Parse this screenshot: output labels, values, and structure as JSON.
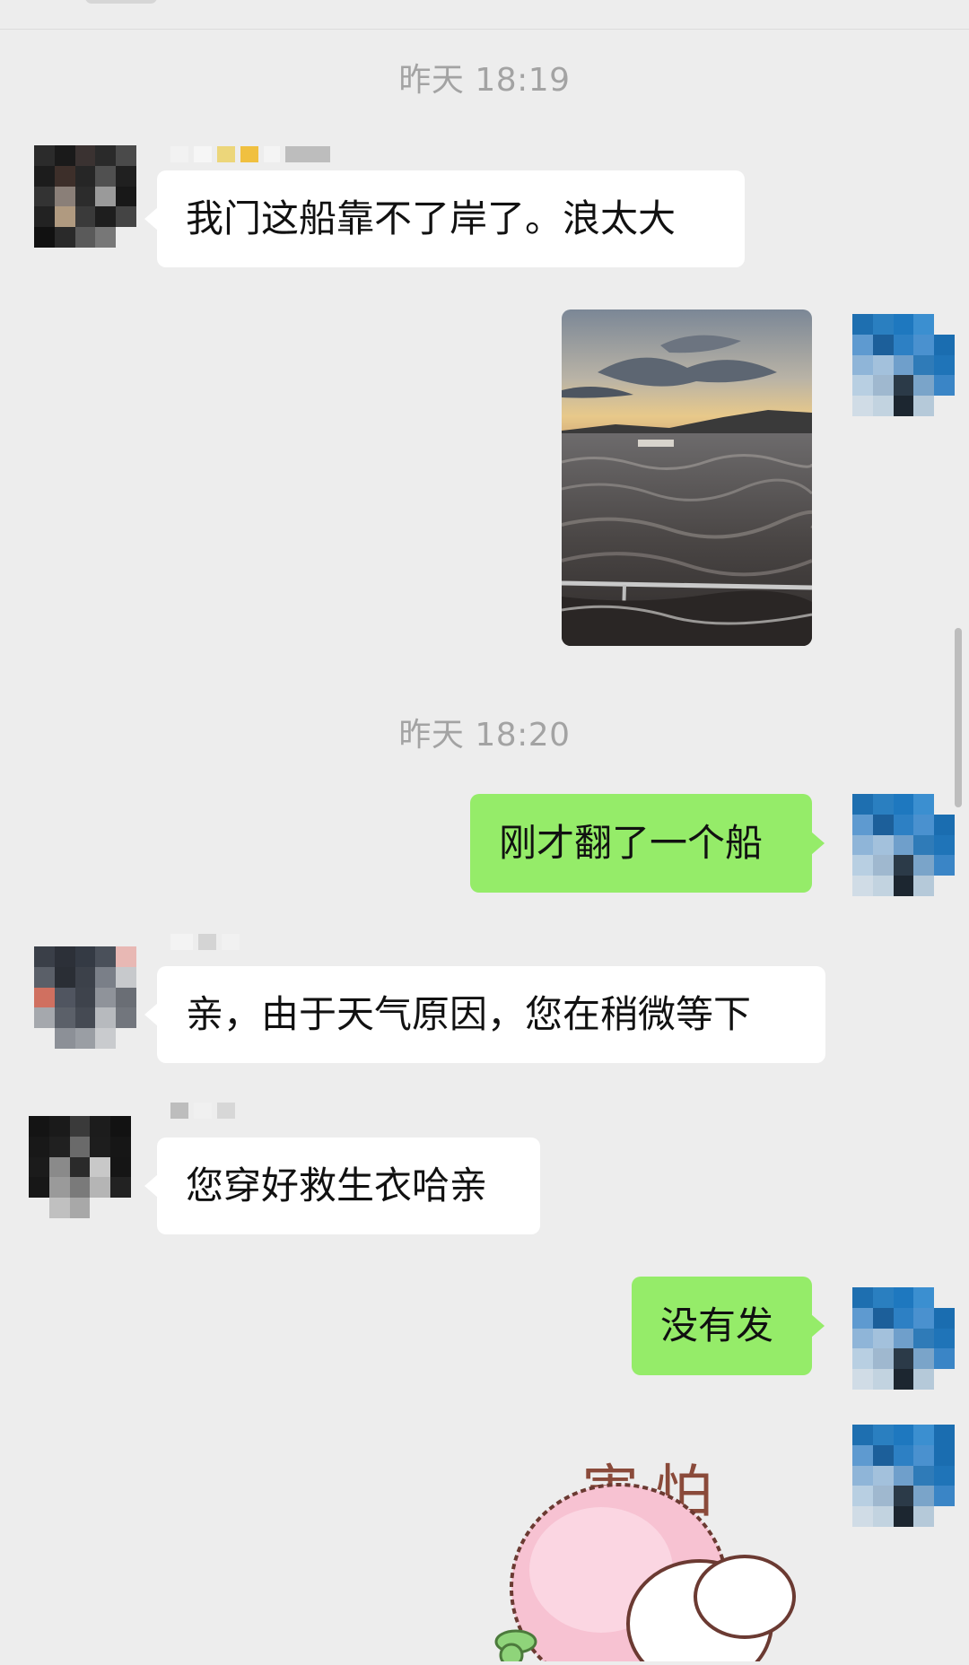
{
  "chat": {
    "timestamps": [
      "昨天 18:19",
      "昨天 18:20"
    ],
    "messages": [
      {
        "side": "incoming",
        "type": "text",
        "text": "我门这船靠不了岸了。浪太大"
      },
      {
        "side": "outgoing",
        "type": "image",
        "content": "photo of rough sea at dusk"
      },
      {
        "side": "outgoing",
        "type": "text",
        "text": "刚才翻了一个船"
      },
      {
        "side": "incoming",
        "type": "text",
        "text": "亲，由于天气原因，您在稍微等下"
      },
      {
        "side": "incoming",
        "type": "text",
        "text": "您穿好救生衣哈亲"
      },
      {
        "side": "outgoing",
        "type": "text",
        "text": "没有发"
      },
      {
        "side": "outgoing",
        "type": "sticker",
        "text": "害怕"
      }
    ]
  },
  "colors": {
    "background": "#ededed",
    "incoming_bubble": "#ffffff",
    "outgoing_bubble": "#95ec69",
    "timestamp": "#a3a3a3"
  }
}
